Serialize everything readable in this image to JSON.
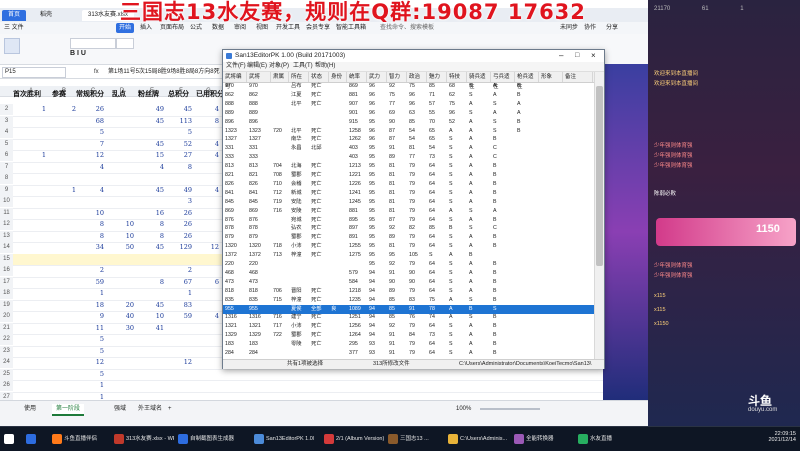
{
  "overlay": {
    "banner": "三国志13水友赛，规则在Q群:19087 17632",
    "chat_lines": [
      {
        "name": "",
        "text": "欢迎来到本直播间",
        "color": "#ffd27a"
      },
      {
        "name": "",
        "text": "欢迎来到本直播间",
        "color": "#ffd27a"
      },
      {
        "name": "",
        "text": "少年强则体育强",
        "color": "#ff8a8a"
      },
      {
        "name": "",
        "text": "少年强则体育强",
        "color": "#ff8a8a"
      },
      {
        "name": "",
        "text": "少年强则体育强",
        "color": "#ff8a8a"
      },
      {
        "name": "",
        "text": "陈弱必败",
        "color": "#ffffff"
      },
      {
        "name": "",
        "text": "少年强则体育强",
        "color": "#ff8a8a"
      },
      {
        "name": "",
        "text": "少年强则体育强",
        "color": "#ff8a8a"
      },
      {
        "name": "",
        "text": "x115",
        "color": "#ffd27a"
      },
      {
        "name": "",
        "text": "x115",
        "color": "#ffd27a"
      },
      {
        "name": "",
        "text": "x1150",
        "color": "#ffd27a"
      }
    ],
    "chat_counts": [
      "21170",
      "61",
      "1"
    ],
    "gift_label": "1150",
    "logo_text": "斗鱼",
    "logo_sub": "douyu.com"
  },
  "spreadsheet": {
    "window_tabs": [
      {
        "label": "首页",
        "active": true
      },
      {
        "label": "稻壳",
        "active": false
      },
      {
        "label": "313水友赛.xlsx",
        "active": false
      }
    ],
    "menu": [
      "三 文件",
      "",
      "",
      "",
      "开始",
      "插入",
      "页面布局",
      "公式",
      "数据",
      "审阅",
      "视图",
      "开发工具",
      "会员专享",
      "智能工具箱",
      "查找命令、搜索模板",
      "未同步",
      "协作",
      "分享"
    ],
    "name_box": "P15",
    "formula_text": "第1场11号5次15局8胜9场8胜8局8方向8死（总最少胜负，0胜次",
    "columns": [
      "A",
      "B",
      "C",
      "D",
      "E",
      "F",
      "G",
      "H",
      "I",
      "J"
    ],
    "headers": [
      "首次胜利",
      "参赛",
      "常规积分",
      "乱点",
      "粉丝牌",
      "总积分",
      "已用积分"
    ],
    "rows": [
      {
        "n": "2",
        "c": [
          "1",
          "2",
          "26",
          "",
          "49",
          "45",
          "4"
        ]
      },
      {
        "n": "3",
        "c": [
          "",
          "",
          "68",
          "",
          "45",
          "113",
          "8"
        ]
      },
      {
        "n": "4",
        "c": [
          "",
          "",
          "5",
          "",
          "",
          "5",
          ""
        ]
      },
      {
        "n": "5",
        "c": [
          "",
          "",
          "7",
          "",
          "45",
          "52",
          "4"
        ]
      },
      {
        "n": "6",
        "c": [
          "1",
          "",
          "12",
          "",
          "15",
          "27",
          "4"
        ]
      },
      {
        "n": "7",
        "c": [
          "",
          "",
          "4",
          "",
          "4",
          "8",
          ""
        ]
      },
      {
        "n": "8",
        "c": [
          "",
          "",
          "",
          "",
          "",
          "",
          ""
        ]
      },
      {
        "n": "9",
        "c": [
          "",
          "1",
          "4",
          "",
          "45",
          "49",
          "4"
        ]
      },
      {
        "n": "10",
        "c": [
          "",
          "",
          "",
          "",
          "",
          "3",
          ""
        ]
      },
      {
        "n": "11",
        "c": [
          "",
          "",
          "10",
          "",
          "16",
          "26",
          ""
        ]
      },
      {
        "n": "12",
        "c": [
          "",
          "",
          "8",
          "10",
          "8",
          "26",
          ""
        ]
      },
      {
        "n": "13",
        "c": [
          "",
          "",
          "8",
          "10",
          "8",
          "26",
          ""
        ]
      },
      {
        "n": "14",
        "c": [
          "",
          "",
          "34",
          "50",
          "45",
          "129",
          "12"
        ]
      },
      {
        "n": "15",
        "c": [
          "",
          "",
          "",
          "",
          "",
          "",
          ""
        ]
      },
      {
        "n": "16",
        "c": [
          "",
          "",
          "2",
          "",
          "",
          "2",
          ""
        ]
      },
      {
        "n": "17",
        "c": [
          "",
          "",
          "59",
          "",
          "8",
          "67",
          "6"
        ]
      },
      {
        "n": "18",
        "c": [
          "",
          "",
          "1",
          "",
          "",
          "1",
          ""
        ]
      },
      {
        "n": "19",
        "c": [
          "",
          "",
          "18",
          "20",
          "45",
          "83",
          ""
        ]
      },
      {
        "n": "20",
        "c": [
          "",
          "",
          "9",
          "40",
          "10",
          "59",
          "4"
        ]
      },
      {
        "n": "21",
        "c": [
          "",
          "",
          "11",
          "30",
          "41",
          "",
          ""
        ]
      },
      {
        "n": "22",
        "c": [
          "",
          "",
          "5",
          "",
          "",
          "",
          ""
        ]
      },
      {
        "n": "23",
        "c": [
          "",
          "",
          "5",
          "",
          "",
          "",
          ""
        ]
      },
      {
        "n": "24",
        "c": [
          "",
          "",
          "12",
          "",
          "",
          "12",
          ""
        ]
      },
      {
        "n": "25",
        "c": [
          "",
          "",
          "5",
          "",
          "",
          "",
          ""
        ]
      },
      {
        "n": "26",
        "c": [
          "",
          "",
          "1",
          "",
          "",
          "",
          ""
        ]
      },
      {
        "n": "27",
        "c": [
          "",
          "",
          "1",
          "",
          "",
          "",
          ""
        ]
      }
    ],
    "sheet_tabs": [
      "使用",
      "第一阶段",
      "",
      "强域",
      "外王域名"
    ],
    "zoom": "100%"
  },
  "editor": {
    "title": "San13EditorPK 1.00 (Build 20171003)",
    "menu": [
      "文件(F)",
      "编辑(E)",
      "对象(P)",
      "工具(T)",
      "帮助(H)"
    ],
    "columns": [
      "武将编号",
      "武将",
      "肃属",
      "所在",
      "状态",
      "身份",
      "统率",
      "武力",
      "智力",
      "政治",
      "魅力",
      "特技",
      "骑兵适性",
      "弓兵适性",
      "枪兵适性",
      "形象",
      "备注"
    ],
    "rows": [
      [
        "970",
        "970",
        "",
        "吕布",
        "死亡",
        "",
        "869",
        "96",
        "92",
        "75",
        "85",
        "68",
        "S",
        "A",
        "B",
        ""
      ],
      [
        "862",
        "862",
        "",
        "江夏",
        "死亡",
        "",
        "881",
        "96",
        "75",
        "96",
        "71",
        "62",
        "S",
        "A",
        "B",
        ""
      ],
      [
        "888",
        "888",
        "",
        "北平",
        "死亡",
        "",
        "907",
        "96",
        "77",
        "96",
        "57",
        "75",
        "A",
        "S",
        "A",
        ""
      ],
      [
        "889",
        "889",
        "",
        "",
        "",
        "",
        "901",
        "96",
        "69",
        "63",
        "55",
        "96",
        "S",
        "A",
        "A",
        ""
      ],
      [
        "896",
        "896",
        "",
        "",
        "",
        "",
        "915",
        "95",
        "90",
        "85",
        "70",
        "52",
        "A",
        "S",
        "B",
        ""
      ],
      [
        "1323",
        "1323",
        "720",
        "北平",
        "死亡",
        "",
        "1258",
        "96",
        "87",
        "54",
        "65",
        "A",
        "A",
        "S",
        "B",
        ""
      ],
      [
        "1327",
        "1327",
        "",
        "南华",
        "死亡",
        "",
        "1262",
        "96",
        "87",
        "54",
        "65",
        "S",
        "A",
        "B",
        ""
      ],
      [
        "331",
        "331",
        "",
        "永昌",
        "北邱",
        "",
        "403",
        "95",
        "91",
        "81",
        "54",
        "S",
        "A",
        "C",
        ""
      ],
      [
        "333",
        "333",
        "",
        "",
        "",
        "",
        "403",
        "95",
        "89",
        "77",
        "73",
        "S",
        "A",
        "C",
        ""
      ],
      [
        "813",
        "813",
        "704",
        "北海",
        "死亡",
        "",
        "1213",
        "95",
        "81",
        "79",
        "64",
        "S",
        "A",
        "B",
        ""
      ],
      [
        "821",
        "821",
        "708",
        "蜀郡",
        "死亡",
        "",
        "1221",
        "95",
        "81",
        "79",
        "64",
        "S",
        "A",
        "B",
        ""
      ],
      [
        "826",
        "826",
        "710",
        "会稽",
        "死亡",
        "",
        "1226",
        "95",
        "81",
        "79",
        "64",
        "S",
        "A",
        "B",
        ""
      ],
      [
        "841",
        "841",
        "712",
        "新城",
        "死亡",
        "",
        "1241",
        "95",
        "81",
        "79",
        "64",
        "S",
        "A",
        "B",
        ""
      ],
      [
        "845",
        "845",
        "719",
        "安陆",
        "死亡",
        "",
        "1245",
        "95",
        "81",
        "79",
        "64",
        "S",
        "A",
        "B",
        ""
      ],
      [
        "869",
        "869",
        "716",
        "安陵",
        "死亡",
        "",
        "881",
        "95",
        "81",
        "79",
        "64",
        "A",
        "S",
        "A",
        ""
      ],
      [
        "876",
        "876",
        "",
        "宛城",
        "死亡",
        "",
        "895",
        "95",
        "87",
        "79",
        "64",
        "S",
        "A",
        "B",
        ""
      ],
      [
        "878",
        "878",
        "",
        "弘农",
        "死亡",
        "",
        "897",
        "95",
        "92",
        "82",
        "85",
        "B",
        "S",
        "C",
        ""
      ],
      [
        "879",
        "879",
        "",
        "蜀郡",
        "死亡",
        "",
        "891",
        "95",
        "89",
        "79",
        "64",
        "S",
        "A",
        "B",
        ""
      ],
      [
        "1320",
        "1320",
        "718",
        "小沛",
        "死亡",
        "",
        "1255",
        "95",
        "81",
        "79",
        "64",
        "S",
        "A",
        "B",
        ""
      ],
      [
        "1372",
        "1372",
        "713",
        "梓潼",
        "死亡",
        "",
        "1275",
        "95",
        "95",
        "105",
        "S",
        "A",
        "B",
        ""
      ],
      [
        "220",
        "220",
        "",
        "",
        "",
        "",
        "",
        "95",
        "92",
        "79",
        "64",
        "S",
        "A",
        "B",
        ""
      ],
      [
        "468",
        "468",
        "",
        "",
        "",
        "",
        "579",
        "94",
        "91",
        "90",
        "64",
        "S",
        "A",
        "B",
        ""
      ],
      [
        "473",
        "473",
        "",
        "",
        "",
        "",
        "584",
        "94",
        "90",
        "90",
        "64",
        "S",
        "A",
        "B",
        ""
      ],
      [
        "818",
        "818",
        "706",
        "晋阳",
        "死亡",
        "",
        "1218",
        "94",
        "89",
        "79",
        "64",
        "S",
        "A",
        "B",
        ""
      ],
      [
        "835",
        "835",
        "715",
        "梓潼",
        "死亡",
        "",
        "1235",
        "94",
        "85",
        "83",
        "75",
        "A",
        "S",
        "B",
        ""
      ],
      [
        "955",
        "955",
        "",
        "夏侯",
        "全部",
        "良",
        "1089",
        "94",
        "85",
        "91",
        "78",
        "A",
        "B",
        "S",
        ""
      ],
      [
        "1316",
        "1316",
        "716",
        "建宁",
        "死亡",
        "",
        "1251",
        "94",
        "85",
        "76",
        "74",
        "A",
        "S",
        "B",
        ""
      ],
      [
        "1321",
        "1321",
        "717",
        "小沛",
        "死亡",
        "",
        "1256",
        "94",
        "92",
        "79",
        "64",
        "S",
        "A",
        "B",
        ""
      ],
      [
        "1329",
        "1329",
        "722",
        "蜀郡",
        "死亡",
        "",
        "1264",
        "94",
        "91",
        "84",
        "73",
        "S",
        "A",
        "B",
        ""
      ],
      [
        "183",
        "183",
        "",
        "零陵",
        "死亡",
        "",
        "295",
        "93",
        "91",
        "79",
        "64",
        "S",
        "A",
        "B",
        ""
      ],
      [
        "284",
        "284",
        "",
        "",
        "",
        "",
        "377",
        "93",
        "91",
        "79",
        "64",
        "S",
        "A",
        "B",
        ""
      ]
    ],
    "selected_row": 25,
    "status_left": "共有1项被选择",
    "status_mid": "313所修改文件",
    "status_right": "C:\\Users\\Administrator\\Documents\\KoeiTecmo\\San13\\"
  },
  "taskbar": {
    "items": [
      {
        "label": "",
        "color": "#ffffff"
      },
      {
        "label": "",
        "color": "#2d6cdf"
      },
      {
        "label": "斗鱼直播伴侣",
        "color": "#ff7a1a"
      },
      {
        "label": "313水友赛.xlsx - WPS",
        "color": "#c0392b"
      },
      {
        "label": "自制截图表生成器",
        "color": "#2d6cdf"
      },
      {
        "label": "San13EditorPK 1.00",
        "color": "#4c8bd9"
      },
      {
        "label": "2/1 (Album Version)",
        "color": "#d43a3a"
      },
      {
        "label": "三国志13 ...",
        "color": "#8a5a2b"
      },
      {
        "label": "C:\\Users\\Adminis...",
        "color": "#e8b339"
      },
      {
        "label": "全能转换器",
        "color": "#9b59b6"
      },
      {
        "label": "水友直播",
        "color": "#27ae60"
      }
    ],
    "clock_time": "22:09:15",
    "clock_date": "2021/12/14"
  }
}
